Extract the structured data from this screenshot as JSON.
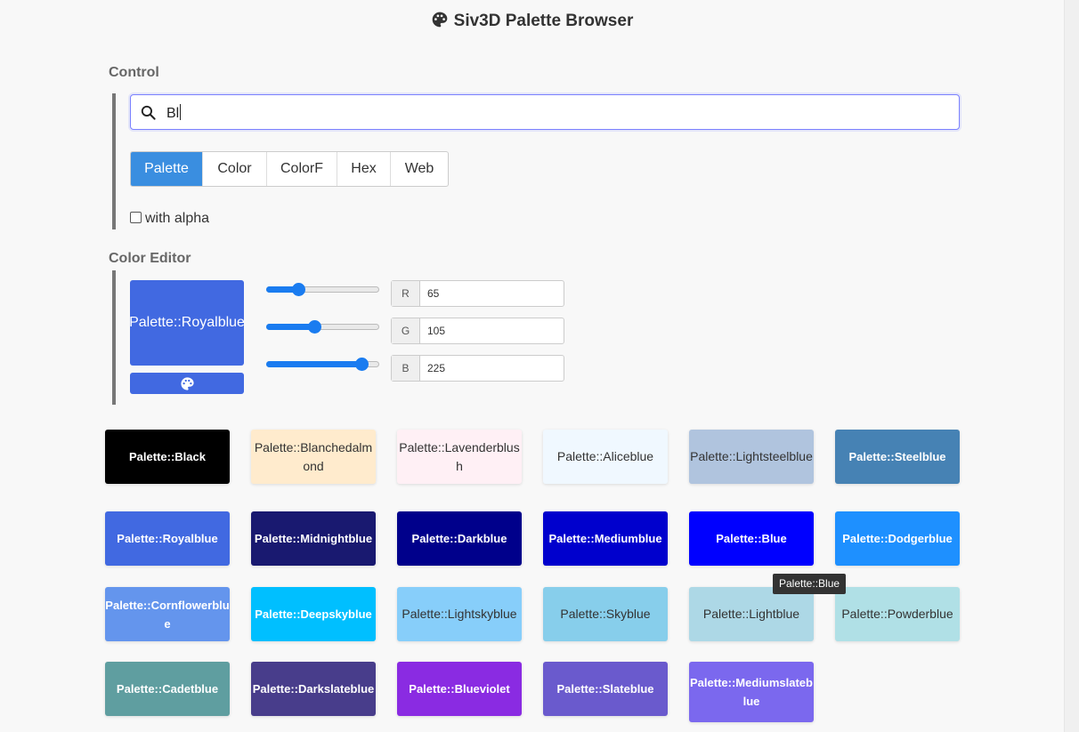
{
  "app": {
    "title": "Siv3D Palette Browser",
    "title_icon": "palette-icon"
  },
  "control": {
    "label": "Control",
    "search": {
      "value": "Bl",
      "icon": "search-icon"
    },
    "formats": [
      {
        "label": "Palette",
        "active": true
      },
      {
        "label": "Color",
        "active": false
      },
      {
        "label": "ColorF",
        "active": false
      },
      {
        "label": "Hex",
        "active": false
      },
      {
        "label": "Web",
        "active": false
      }
    ],
    "with_alpha": {
      "label": "with alpha",
      "checked": false
    }
  },
  "editor": {
    "label": "Color Editor",
    "preview_label": "Palette::Royalblue",
    "preview_color": "#4169e1",
    "picker_icon": "palette-icon",
    "channels": [
      {
        "name": "R",
        "value": "65",
        "fraction": 0.255
      },
      {
        "name": "G",
        "value": "105",
        "fraction": 0.412
      },
      {
        "name": "B",
        "value": "225",
        "fraction": 0.882
      }
    ]
  },
  "tiles": [
    {
      "label": "Palette::Black",
      "bg": "#000000",
      "fg": "#ffffff",
      "bold": true
    },
    {
      "label": "Palette::Blanchedalmond",
      "bg": "#ffebcd",
      "fg": "#333333",
      "bold": false
    },
    {
      "label": "Palette::Lavenderblush",
      "bg": "#fff0f5",
      "fg": "#333333",
      "bold": false
    },
    {
      "label": "Palette::Aliceblue",
      "bg": "#f0f8ff",
      "fg": "#333333",
      "bold": false
    },
    {
      "label": "Palette::Lightsteelblue",
      "bg": "#b0c4de",
      "fg": "#333333",
      "bold": false
    },
    {
      "label": "Palette::Steelblue",
      "bg": "#4682b4",
      "fg": "#ffffff",
      "bold": true
    },
    {
      "label": "Palette::Royalblue",
      "bg": "#4169e1",
      "fg": "#ffffff",
      "bold": true
    },
    {
      "label": "Palette::Midnightblue",
      "bg": "#191970",
      "fg": "#ffffff",
      "bold": true
    },
    {
      "label": "Palette::Darkblue",
      "bg": "#00008b",
      "fg": "#ffffff",
      "bold": true
    },
    {
      "label": "Palette::Mediumblue",
      "bg": "#0000cd",
      "fg": "#ffffff",
      "bold": true
    },
    {
      "label": "Palette::Blue",
      "bg": "#0000ff",
      "fg": "#ffffff",
      "bold": true
    },
    {
      "label": "Palette::Dodgerblue",
      "bg": "#1e90ff",
      "fg": "#ffffff",
      "bold": true
    },
    {
      "label": "Palette::Cornflowerblue",
      "bg": "#6495ed",
      "fg": "#ffffff",
      "bold": true
    },
    {
      "label": "Palette::Deepskyblue",
      "bg": "#00bfff",
      "fg": "#ffffff",
      "bold": true
    },
    {
      "label": "Palette::Lightskyblue",
      "bg": "#87cefa",
      "fg": "#333333",
      "bold": false
    },
    {
      "label": "Palette::Skyblue",
      "bg": "#87ceeb",
      "fg": "#333333",
      "bold": false
    },
    {
      "label": "Palette::Lightblue",
      "bg": "#add8e6",
      "fg": "#333333",
      "bold": false
    },
    {
      "label": "Palette::Powderblue",
      "bg": "#b0e0e6",
      "fg": "#333333",
      "bold": false
    },
    {
      "label": "Palette::Cadetblue",
      "bg": "#5f9ea0",
      "fg": "#ffffff",
      "bold": true
    },
    {
      "label": "Palette::Darkslateblue",
      "bg": "#483d8b",
      "fg": "#ffffff",
      "bold": true
    },
    {
      "label": "Palette::Blueviolet",
      "bg": "#8a2be2",
      "fg": "#ffffff",
      "bold": true
    },
    {
      "label": "Palette::Slateblue",
      "bg": "#6a5acd",
      "fg": "#ffffff",
      "bold": true
    },
    {
      "label": "Palette::Mediumslateblue",
      "bg": "#7b68ee",
      "fg": "#ffffff",
      "bold": true
    }
  ],
  "tooltip": {
    "text": "Palette::Blue"
  }
}
